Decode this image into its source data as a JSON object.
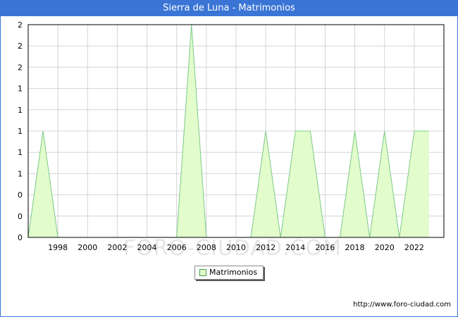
{
  "title": "Sierra de Luna - Matrimonios",
  "watermark": "FORO-CIUDAD.COM",
  "source_url": "http://www.foro-ciudad.com",
  "colors": {
    "title_bg": "#3a75d6",
    "area_fill": "#e2fccc",
    "area_line": "#7ec98a",
    "grid": "#d4d4d4"
  },
  "chart_data": {
    "type": "area",
    "title": "Sierra de Luna - Matrimonios",
    "xlabel": "",
    "ylabel": "",
    "x": [
      1996,
      1997,
      1998,
      1999,
      2000,
      2001,
      2002,
      2003,
      2004,
      2005,
      2006,
      2007,
      2008,
      2009,
      2010,
      2011,
      2012,
      2013,
      2014,
      2015,
      2016,
      2017,
      2018,
      2019,
      2020,
      2021,
      2022,
      2023
    ],
    "series": [
      {
        "name": "Matrimonios",
        "values": [
          0,
          1,
          0,
          0,
          0,
          0,
          0,
          0,
          0,
          0,
          0,
          2,
          0,
          0,
          0,
          0,
          1,
          0,
          1,
          1,
          0,
          0,
          1,
          0,
          1,
          0,
          1,
          1
        ]
      }
    ],
    "xlim": [
      1996,
      2024
    ],
    "ylim": [
      0,
      2
    ],
    "x_ticks": [
      1998,
      2000,
      2002,
      2004,
      2006,
      2008,
      2010,
      2012,
      2014,
      2016,
      2018,
      2020,
      2022
    ],
    "y_ticks": [
      0,
      0.2,
      0.4,
      0.6,
      0.8,
      1,
      1.2,
      1.4,
      1.6,
      1.8,
      2
    ],
    "y_tick_labels": [
      "0",
      "0",
      "0",
      "1",
      "1",
      "1",
      "1",
      "1",
      "2",
      "2",
      "2"
    ],
    "grid": true,
    "legend": [
      "Matrimonios"
    ],
    "legend_position": "bottom-center"
  }
}
